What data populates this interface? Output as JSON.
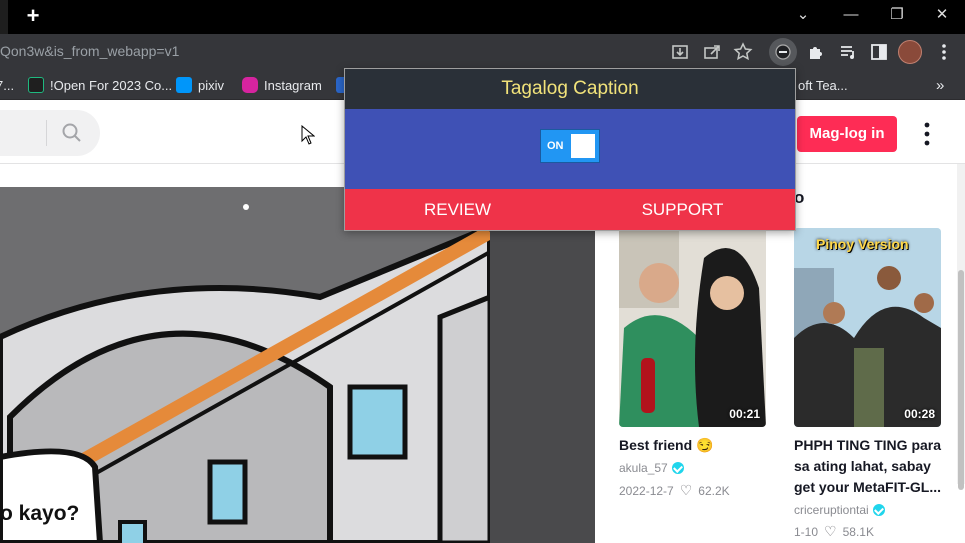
{
  "browser": {
    "new_tab_label": "+",
    "window_controls": {
      "dropdown": "⌄",
      "minimize": "—",
      "restore": "❐",
      "close": "✕"
    },
    "url": "Qon3w&is_from_webapp=v1",
    "bookmarks": [
      {
        "label": "7...",
        "color": "#2a66c9"
      },
      {
        "label": "!Open For 2023 Co...",
        "color": "#1fb980"
      },
      {
        "label": "pixiv",
        "color": "#0096fa"
      },
      {
        "label": "Instagram",
        "color": "#d6249f"
      },
      {
        "label": "oft Tea...",
        "color": "#5059c9"
      }
    ],
    "bookmarks_overflow": "»",
    "toolbar_icons": [
      "download-icon",
      "share-icon",
      "star-icon",
      "extension-active-icon",
      "puzzle-icon",
      "media-icon",
      "sidepanel-icon",
      "profile-avatar",
      "menu-icon"
    ]
  },
  "page": {
    "login_label": "Mag-log in",
    "colors": {
      "brand": "#fe2c55"
    },
    "comic_text": "o kayo?",
    "section_heading_fragment": "o",
    "videos": [
      {
        "duration": "00:21",
        "title": "Best friend 😏",
        "user": "akula_57",
        "verified": true,
        "date": "2022-12-7",
        "likes": "62.2K"
      },
      {
        "duration": "00:28",
        "overlay_text": "Pinoy Version",
        "title_line1": "PHPH TING TING para",
        "title_line2": "sa ating lahat, sabay",
        "title_line3": "get your MetaFIT-GL...",
        "user": "criceruptiontai",
        "verified": true,
        "date": "1-10",
        "likes": "58.1K"
      }
    ]
  },
  "popup": {
    "title": "Tagalog Caption",
    "toggle_label": "ON",
    "toggle_on": true,
    "review_label": "REVIEW",
    "support_label": "SUPPORT",
    "colors": {
      "header": "#2a3038",
      "title": "#f1e27a",
      "body": "#3f51b5",
      "footer": "#ef3349",
      "toggle": "#2196f3"
    }
  }
}
